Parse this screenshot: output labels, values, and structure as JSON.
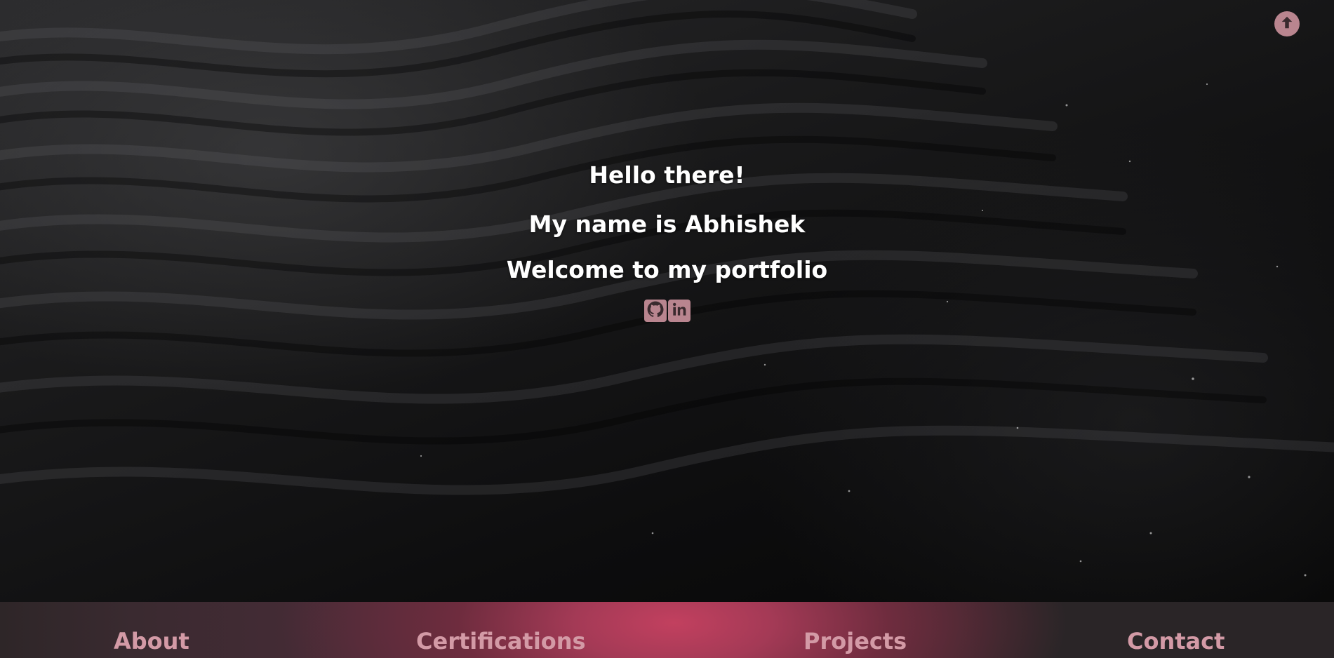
{
  "hero": {
    "greeting": "Hello there!",
    "name_line": "My name is Abhishek",
    "welcome_line": "Welcome to my portfolio"
  },
  "socials": [
    {
      "icon": "github-icon"
    },
    {
      "icon": "linkedin-icon"
    }
  ],
  "scroll_top": {
    "icon": "arrow-up-icon"
  },
  "nav": {
    "about": "About",
    "certifications": "Certifications",
    "projects": "Projects",
    "contact": "Contact"
  },
  "colors": {
    "accent": "#b9858f",
    "nav_text": "#d39aa6",
    "nav_glow": "#c2405f",
    "hero_text": "#ffffff"
  }
}
